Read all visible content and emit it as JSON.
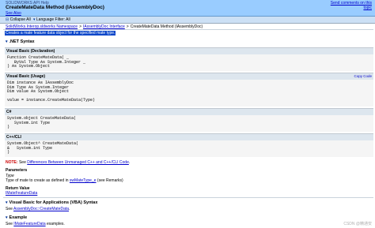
{
  "header": {
    "product": "SOLIDWORKS API Help",
    "title": "CreateMateData Method (IAssemblyDoc)",
    "see_also": "See Also",
    "send_feedback_1": "Send comments on this",
    "send_feedback_2": "topic"
  },
  "filters": {
    "collapse_all": "Collapse All",
    "language_filter": "Language Filter: All"
  },
  "breadcrumb": {
    "item1": "SolidWorks.Interop.sldworks Namespace",
    "item2": "IAssemblyDoc Interface",
    "current": "CreateMateData Method (IAssemblyDoc)"
  },
  "summary": "Creates a mate feature data object for the specified mate type.",
  "syntax": {
    "heading": ".NET Syntax",
    "blocks": [
      {
        "label": "Visual Basic (Declaration)",
        "lines": [
          "Function CreateMateData( _",
          "   ByVal Type As System.Integer _",
          ") As System.Object"
        ]
      },
      {
        "label": "Visual Basic (Usage)",
        "copy": "Copy Code",
        "lines": [
          "Dim instance As IAssemblyDoc",
          "Dim Type As System.Integer",
          "Dim value As System.Object",
          "",
          "value = instance.CreateMateData(Type)"
        ]
      },
      {
        "label": "C#",
        "lines": [
          "System.object CreateMateData(",
          "   System.int Type",
          ")"
        ]
      },
      {
        "label": "C++/CLI",
        "lines": [
          "System.Object^ CreateMateData(",
          "&   System.int Type",
          ")"
        ]
      }
    ]
  },
  "note": {
    "label": "NOTE:",
    "text_pre": "See ",
    "link": "Differences Between Unmanaged C++ and C++/CLI Code",
    "text_post": "."
  },
  "parameters": {
    "heading": "Parameters",
    "name": "Type",
    "desc_pre": "Type of mate to create as defined in ",
    "desc_link": "swMateType_e",
    "desc_post": " (see Remarks)"
  },
  "return_value": {
    "heading": "Return Value",
    "link": "IMateFeatureData"
  },
  "vba": {
    "heading": "Visual Basic for Applications (VBA) Syntax",
    "text_pre": "See ",
    "link": "AssemblyDoc::CreateMateData",
    "text_post": "."
  },
  "example": {
    "heading": "Example",
    "text_pre": "See ",
    "link": "IMateFeatureData",
    "text_post": " examples."
  },
  "watermark": "CSDN @精通安"
}
